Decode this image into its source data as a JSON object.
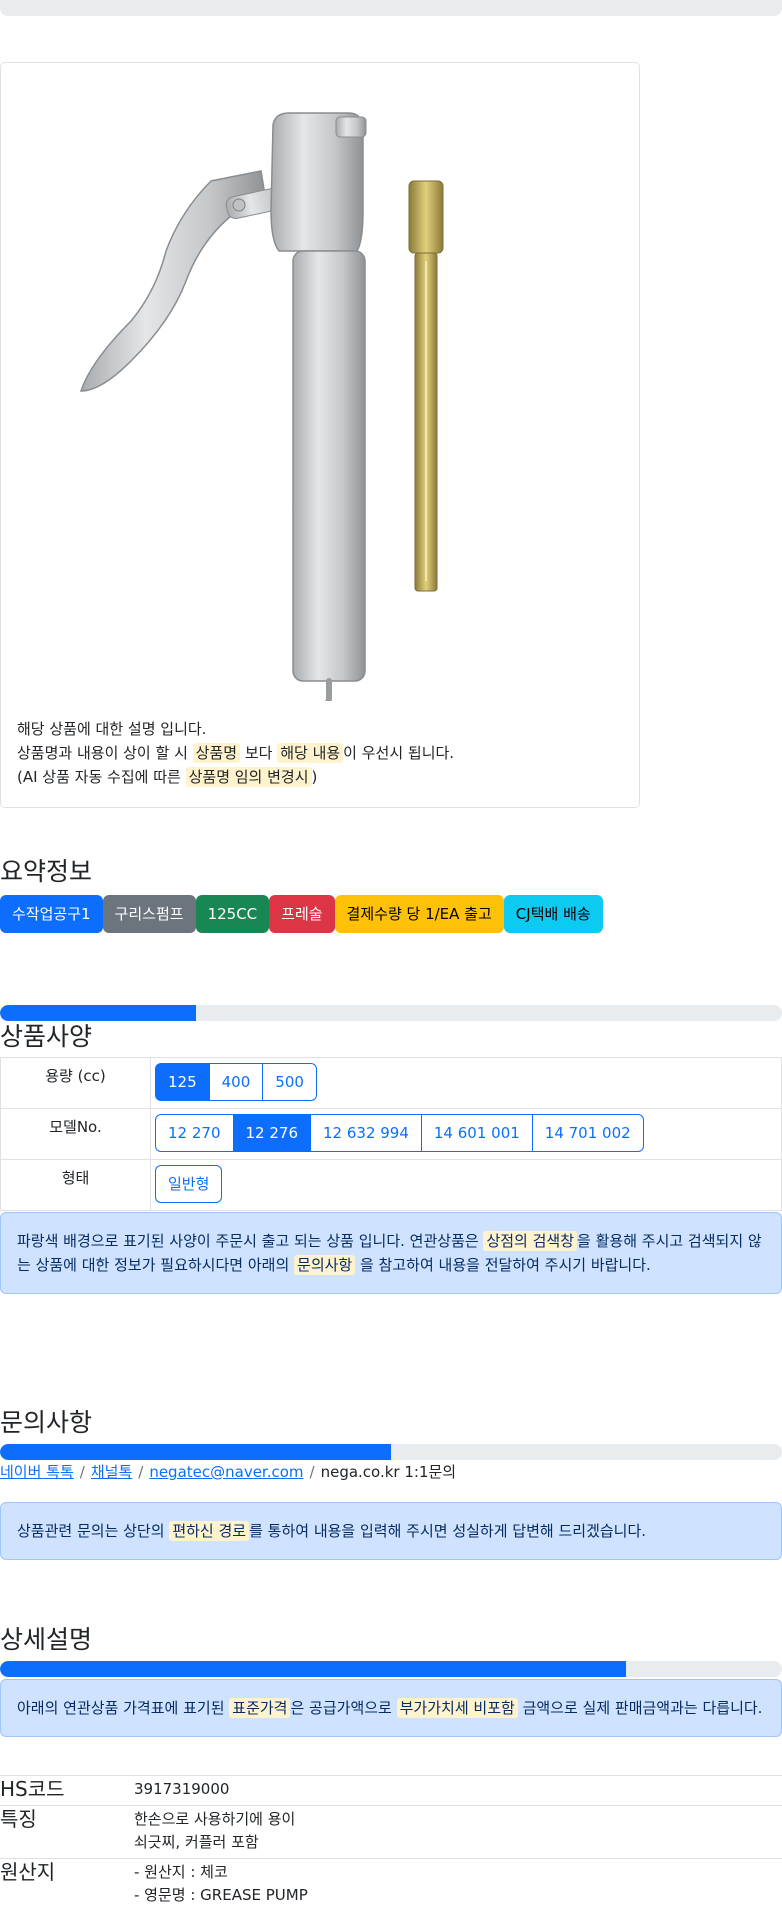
{
  "product": {
    "image_alt": "grease pump",
    "description": {
      "line1": "해당 상품에 대한 설명 입니다.",
      "line2_pre": "상품명과 내용이 상이 할 시 ",
      "line2_hl1": "상품명",
      "line2_mid": " 보다 ",
      "line2_hl2": "해당 내용",
      "line2_post": "이 우선시 됩니다.",
      "line3_pre": "(AI 상품 자동 수집에 따른 ",
      "line3_hl": "상품명 임의 변경시",
      "line3_post": ")"
    }
  },
  "summary": {
    "title": "요약정보",
    "badges": [
      {
        "label": "수작업공구1",
        "color": "#0d6efd"
      },
      {
        "label": "구리스펌프",
        "color": "#6c757d"
      },
      {
        "label": "125CC",
        "color": "#198754"
      },
      {
        "label": "프레술",
        "color": "#dc3545"
      },
      {
        "label": "결제수량 당 1/EA 출고",
        "color": "#ffc107"
      },
      {
        "label": "CJ택배 배송",
        "color": "#0dcaf0"
      }
    ]
  },
  "specs": {
    "title": "상품사양",
    "progress": 0.25,
    "rows": [
      {
        "label": "용량 (cc)",
        "options": [
          "125",
          "400",
          "500"
        ],
        "selected": "125"
      },
      {
        "label": "모델No.",
        "options": [
          "12 270",
          "12 276",
          "12 632 994",
          "14 601 001",
          "14 701 002"
        ],
        "selected": "12 276"
      },
      {
        "label": "형태",
        "options": [
          "일반형"
        ],
        "selected": ""
      }
    ],
    "notice": {
      "pre": "파랑색 배경으로 표기된 사양이 주문시 출고 되는 상품 입니다. 연관상품은 ",
      "hl1": "상점의 검색창",
      "mid": "을 활용해 주시고 검색되지 않는 상품에 대한 정보가 필요하시다면 아래의 ",
      "hl2": "문의사항",
      "post": " 을 참고하여 내용을 전달하여 주시기 바랍니다."
    }
  },
  "inquiry": {
    "title": "문의사항",
    "progress": 0.5,
    "links": [
      "네이버 톡톡",
      "채널톡",
      "negatec@naver.com"
    ],
    "plain": "nega.co.kr 1:1문의",
    "notice": {
      "pre": "상품관련 문의는 상단의 ",
      "hl": "편하신 경로",
      "post": "를 통하여 내용을 입력해 주시면 성실하게 답변해 드리겠습니다."
    }
  },
  "detail": {
    "title": "상세설명",
    "progress": 0.8,
    "notice": {
      "pre": "아래의 연관상품 가격표에 표기된 ",
      "hl1": "표준가격",
      "mid": "은 공급가액으로 ",
      "hl2": "부가가치세 비포함",
      "post": " 금액으로 실제 판매금액과는 다릅니다."
    },
    "rows": [
      {
        "key": "HS코드",
        "values": [
          "3917319000"
        ]
      },
      {
        "key": "특징",
        "values": [
          "한손으로 사용하기에 용이",
          "쇠긋찌, 커플러 포함"
        ]
      },
      {
        "key": "원산지",
        "values": [
          "- 원산지 : 체코",
          "- 영문명 : GREASE PUMP"
        ]
      }
    ]
  }
}
